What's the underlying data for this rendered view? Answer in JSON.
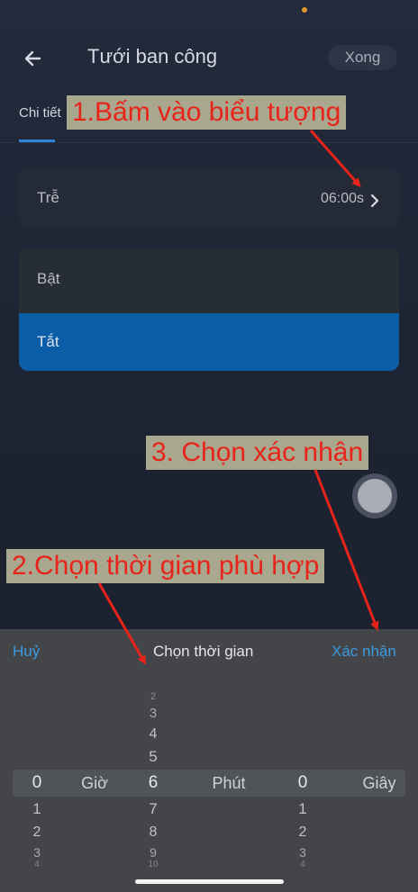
{
  "header": {
    "title": "Tưới ban công",
    "done_label": "Xong",
    "tab_label": "Chi tiết"
  },
  "delay": {
    "label": "Trễ",
    "value": "06:00s"
  },
  "options": {
    "on_label": "Bật",
    "off_label": "Tắt"
  },
  "annotations": {
    "step1": "1.Bấm vào biểu tượng",
    "step2": "2.Chọn thời gian phù hợp",
    "step3": "3. Chọn xác nhận"
  },
  "picker": {
    "cancel_label": "Huỷ",
    "title": "Chọn thời gian",
    "confirm_label": "Xác nhận",
    "hours": {
      "selected": "0",
      "unit": "Giờ",
      "below": [
        "1",
        "2",
        "3",
        "4"
      ]
    },
    "minutes": {
      "above": [
        "2",
        "3",
        "4",
        "5"
      ],
      "selected": "6",
      "unit": "Phút",
      "below": [
        "7",
        "8",
        "9",
        "10"
      ]
    },
    "seconds": {
      "selected": "0",
      "unit": "Giây",
      "below": [
        "1",
        "2",
        "3",
        "4"
      ]
    }
  },
  "colors": {
    "accent": "#3d9be0",
    "selected_row": "#0b5da8",
    "annotation_text": "#e8231a",
    "annotation_bg": "#a9a88f"
  }
}
